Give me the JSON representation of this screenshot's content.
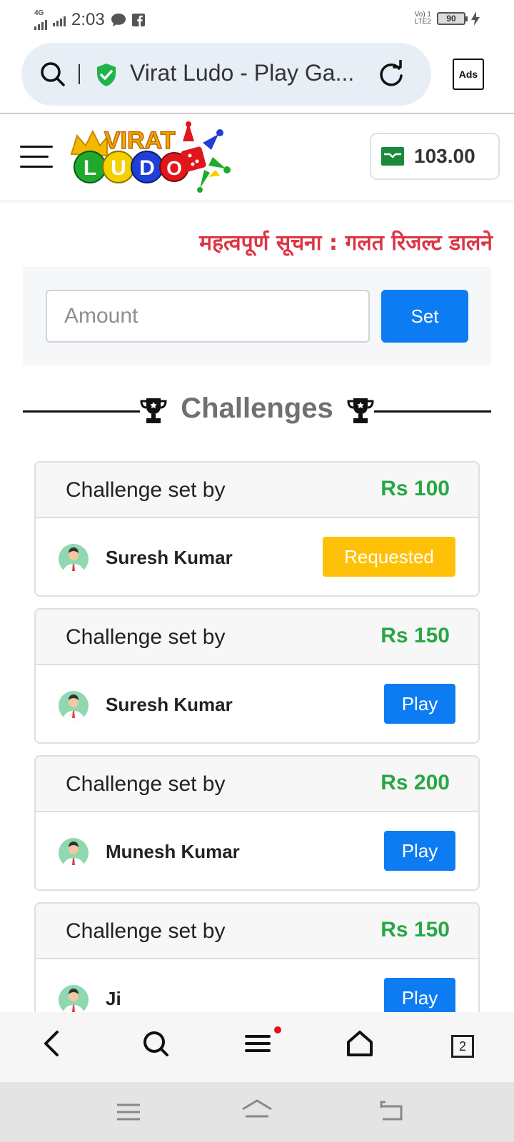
{
  "status_bar": {
    "network": "4G",
    "time": "2:03",
    "volte": "Vo) 1",
    "lte": "LTE2",
    "battery": "90"
  },
  "browser": {
    "page_title": "Virat Ludo - Play Ga...",
    "ads_label": "Ads",
    "tabs_count": "2"
  },
  "header": {
    "logo_text_top": "VIRAT",
    "logo_letters": [
      "L",
      "U",
      "D",
      "O"
    ],
    "wallet_balance": "103.00"
  },
  "notice": "महत्वपूर्ण सूचना : गलत रिजल्ट डालने",
  "amount_form": {
    "placeholder": "Amount",
    "set_label": "Set"
  },
  "challenges": {
    "title": "Challenges",
    "items": [
      {
        "label": "Challenge set by",
        "amount": "Rs 100",
        "player": "Suresh Kumar",
        "action": "Requested"
      },
      {
        "label": "Challenge set by",
        "amount": "Rs 150",
        "player": "Suresh Kumar",
        "action": "Play"
      },
      {
        "label": "Challenge set by",
        "amount": "Rs 200",
        "player": "Munesh Kumar",
        "action": "Play"
      },
      {
        "label": "Challenge set by",
        "amount": "Rs 150",
        "player": "Ji",
        "action": "Play"
      }
    ]
  },
  "colors": {
    "primary": "#0d7bf2",
    "warning": "#ffc107",
    "success": "#28a745",
    "danger": "#dc3545"
  },
  "icons": [
    "search-icon",
    "shield-check-icon",
    "reload-icon",
    "menu-icon",
    "wallet-icon",
    "trophy-icon",
    "avatar-icon",
    "back-icon",
    "home-icon"
  ]
}
